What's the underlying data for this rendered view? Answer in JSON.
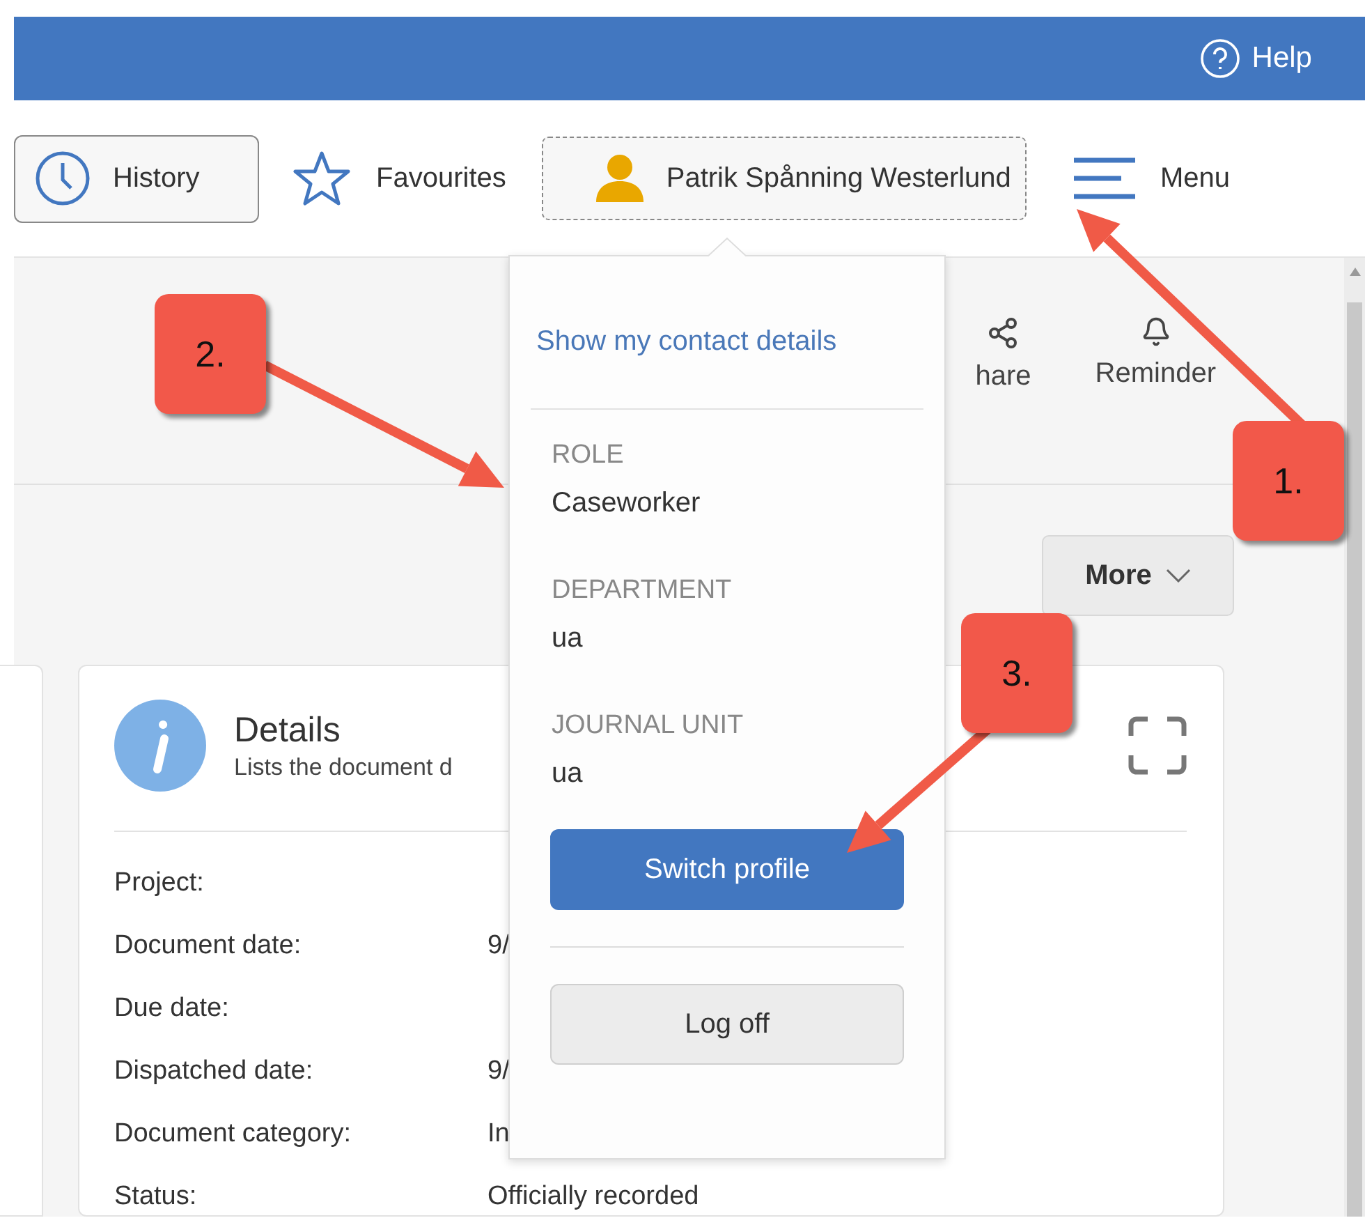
{
  "header": {
    "help": "Help"
  },
  "toolbar": {
    "history": "History",
    "favourites": "Favourites",
    "user": "Patrik Spånning Westerlund",
    "menu": "Menu"
  },
  "actions": [
    {
      "label": "hare",
      "kind": "share"
    },
    {
      "label": "Reminder",
      "kind": "bell"
    }
  ],
  "more_button": "More",
  "details_card": {
    "title": "Details",
    "subtitle": "Lists the document d",
    "fields": [
      {
        "label": "Project:"
      },
      {
        "label": "Document date:",
        "value": "9/"
      },
      {
        "label": "Due date:"
      },
      {
        "label": "Dispatched date:",
        "value": "9/"
      },
      {
        "label": "Document category:",
        "value": "In"
      },
      {
        "label": "Status:",
        "value": "Officially recorded"
      }
    ]
  },
  "profile_menu": {
    "link": "Show my contact details",
    "sections": [
      {
        "label": "ROLE",
        "value": "Caseworker"
      },
      {
        "label": "DEPARTMENT",
        "value": "ua"
      },
      {
        "label": "JOURNAL UNIT",
        "value": "ua"
      }
    ],
    "buttons": [
      {
        "label": "Switch profile",
        "kind": "primary"
      },
      {
        "label": "Log off",
        "kind": "secondary"
      }
    ]
  },
  "callouts": [
    {
      "label": "1."
    },
    {
      "label": "2."
    },
    {
      "label": "3."
    }
  ]
}
